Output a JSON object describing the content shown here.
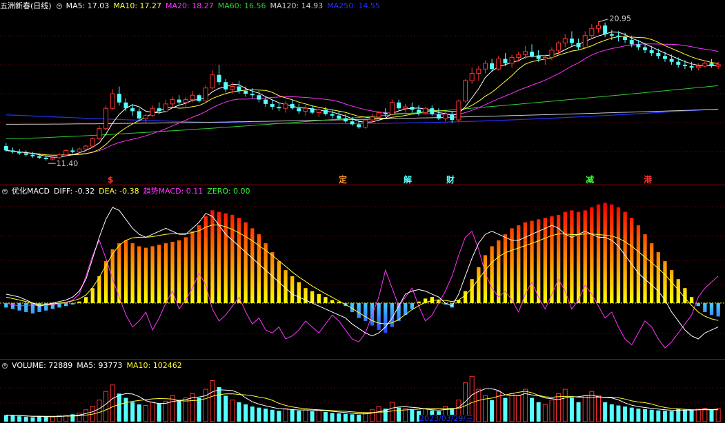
{
  "colors": {
    "bg": "#000000",
    "up": "#ff3333",
    "down": "#54ffff",
    "ma5": "#ffffff",
    "ma10": "#ffff33",
    "ma20": "#ff33ff",
    "ma60": "#33cc33",
    "ma120": "#cccccc",
    "ma250": "#2233ff",
    "grid": "#880000"
  },
  "price_panel": {
    "stock_name": "五洲新春(日线)",
    "ma5": "MA5: 17.03",
    "ma10": "MA10: 17.27",
    "ma20": "MA20: 18.27",
    "ma60": "MA60: 16.56",
    "ma120": "MA120: 14.93",
    "ma250": "MA250: 14.55",
    "high_label": "20.95",
    "low_label": "11.40",
    "events": [
      {
        "label": "$",
        "color": "#ff3333"
      },
      {
        "label": "定",
        "color": "#ff9933"
      },
      {
        "label": "解",
        "color": "#54ffff"
      },
      {
        "label": "财",
        "color": "#54ffff"
      },
      {
        "label": "减",
        "color": "#33ff33"
      },
      {
        "label": "港",
        "color": "#ff3333"
      }
    ]
  },
  "macd_panel": {
    "name": "优化MACD",
    "diff": "DIFF: -0.32",
    "dea": "DEA: -0.38",
    "trend_label": "趋势",
    "macd": "MACD: 0.11",
    "zero": "ZERO: 0.00"
  },
  "volume_panel": {
    "volume": "VOLUME: 72889",
    "ma5": "MA5: 93773",
    "ma10": "MA10: 102462",
    "date_label": "2023/03/29/三"
  },
  "chart_data": [
    {
      "type": "candlestick",
      "title": "五洲新春(日线)",
      "ylim": [
        10.6,
        21.6
      ],
      "ohlc": [
        [
          12.4,
          12.6,
          12.0,
          12.1
        ],
        [
          12.1,
          12.3,
          11.9,
          12.0
        ],
        [
          12.0,
          12.2,
          11.8,
          11.9
        ],
        [
          11.9,
          12.1,
          11.7,
          11.8
        ],
        [
          11.8,
          12.0,
          11.6,
          11.7
        ],
        [
          11.7,
          11.9,
          11.5,
          11.6
        ],
        [
          11.6,
          11.8,
          11.4,
          11.5
        ],
        [
          11.5,
          11.7,
          11.4,
          11.6
        ],
        [
          11.6,
          11.9,
          11.5,
          11.8
        ],
        [
          11.8,
          12.2,
          11.7,
          12.1
        ],
        [
          12.1,
          12.3,
          11.9,
          12.0
        ],
        [
          12.0,
          12.3,
          11.8,
          12.2
        ],
        [
          12.2,
          12.5,
          12.0,
          12.4
        ],
        [
          12.4,
          13.0,
          12.3,
          12.9
        ],
        [
          12.9,
          13.8,
          12.8,
          13.6
        ],
        [
          13.6,
          15.2,
          13.5,
          15.0
        ],
        [
          15.0,
          16.3,
          14.9,
          16.0
        ],
        [
          16.0,
          16.5,
          15.2,
          15.4
        ],
        [
          15.4,
          15.7,
          14.8,
          15.0
        ],
        [
          15.0,
          15.3,
          14.5,
          14.8
        ],
        [
          14.8,
          15.0,
          14.1,
          14.3
        ],
        [
          14.3,
          14.6,
          14.0,
          14.5
        ],
        [
          14.5,
          15.2,
          14.4,
          15.0
        ],
        [
          15.0,
          15.4,
          14.6,
          14.8
        ],
        [
          14.8,
          15.6,
          14.7,
          15.3
        ],
        [
          15.3,
          15.8,
          15.1,
          15.6
        ],
        [
          15.6,
          15.9,
          15.2,
          15.4
        ],
        [
          15.4,
          15.8,
          15.1,
          15.6
        ],
        [
          15.6,
          16.2,
          15.4,
          15.9
        ],
        [
          15.9,
          16.0,
          15.4,
          15.5
        ],
        [
          15.5,
          16.6,
          15.4,
          16.4
        ],
        [
          16.4,
          17.6,
          16.3,
          17.3
        ],
        [
          17.3,
          18.0,
          16.6,
          16.8
        ],
        [
          16.8,
          17.0,
          16.1,
          16.3
        ],
        [
          16.3,
          16.8,
          16.0,
          16.5
        ],
        [
          16.5,
          16.9,
          16.0,
          16.2
        ],
        [
          16.2,
          16.5,
          15.8,
          16.0
        ],
        [
          16.0,
          16.4,
          15.7,
          15.9
        ],
        [
          15.9,
          16.2,
          15.4,
          15.6
        ],
        [
          15.6,
          15.8,
          15.1,
          15.3
        ],
        [
          15.3,
          15.6,
          14.9,
          15.1
        ],
        [
          15.1,
          15.4,
          14.8,
          15.0
        ],
        [
          15.0,
          15.5,
          14.7,
          15.3
        ],
        [
          15.3,
          15.6,
          14.9,
          15.0
        ],
        [
          15.0,
          15.3,
          14.6,
          14.8
        ],
        [
          14.8,
          15.2,
          14.5,
          15.0
        ],
        [
          15.0,
          15.2,
          14.6,
          14.7
        ],
        [
          14.7,
          15.0,
          14.4,
          14.9
        ],
        [
          14.9,
          15.1,
          14.5,
          14.6
        ],
        [
          14.6,
          14.9,
          14.3,
          14.5
        ],
        [
          14.5,
          14.8,
          14.2,
          14.3
        ],
        [
          14.3,
          14.6,
          14.0,
          14.1
        ],
        [
          14.1,
          14.4,
          13.8,
          13.9
        ],
        [
          13.9,
          14.2,
          13.6,
          13.7
        ],
        [
          13.7,
          14.3,
          13.6,
          14.2
        ],
        [
          14.2,
          14.6,
          14.0,
          14.4
        ],
        [
          14.4,
          14.8,
          14.3,
          14.7
        ],
        [
          14.7,
          15.0,
          14.4,
          14.6
        ],
        [
          14.6,
          15.6,
          14.5,
          15.4
        ],
        [
          15.4,
          15.6,
          14.9,
          15.0
        ],
        [
          15.0,
          15.3,
          14.7,
          15.1
        ],
        [
          15.1,
          15.4,
          14.7,
          14.9
        ],
        [
          14.9,
          15.2,
          14.5,
          14.7
        ],
        [
          14.7,
          15.1,
          14.6,
          15.0
        ],
        [
          15.0,
          15.2,
          14.5,
          14.6
        ],
        [
          14.6,
          15.0,
          14.2,
          14.3
        ],
        [
          14.3,
          14.8,
          14.1,
          14.6
        ],
        [
          14.6,
          14.8,
          14.0,
          14.2
        ],
        [
          14.2,
          15.6,
          14.1,
          15.5
        ],
        [
          15.5,
          17.0,
          15.4,
          16.9
        ],
        [
          16.9,
          17.8,
          16.7,
          17.4
        ],
        [
          17.4,
          17.9,
          16.9,
          17.7
        ],
        [
          17.7,
          18.3,
          17.4,
          18.1
        ],
        [
          18.1,
          18.4,
          17.5,
          17.7
        ],
        [
          17.7,
          18.6,
          17.6,
          18.4
        ],
        [
          18.4,
          18.8,
          17.9,
          18.1
        ],
        [
          18.1,
          18.7,
          17.8,
          18.5
        ],
        [
          18.5,
          18.9,
          18.2,
          18.7
        ],
        [
          18.7,
          19.3,
          18.4,
          18.9
        ],
        [
          18.9,
          19.4,
          18.5,
          18.6
        ],
        [
          18.6,
          19.0,
          18.2,
          18.4
        ],
        [
          18.4,
          18.7,
          18.0,
          18.5
        ],
        [
          18.5,
          19.2,
          18.3,
          19.0
        ],
        [
          19.0,
          19.6,
          18.8,
          19.5
        ],
        [
          19.5,
          20.1,
          19.2,
          19.8
        ],
        [
          19.8,
          20.3,
          19.3,
          19.5
        ],
        [
          19.5,
          19.8,
          19.0,
          19.2
        ],
        [
          19.2,
          20.3,
          19.1,
          20.0
        ],
        [
          20.0,
          20.8,
          19.8,
          20.5
        ],
        [
          20.5,
          20.95,
          20.2,
          20.7
        ],
        [
          20.7,
          20.9,
          19.9,
          20.1
        ],
        [
          20.1,
          20.4,
          19.7,
          20.0
        ],
        [
          20.0,
          20.3,
          19.6,
          19.9
        ],
        [
          19.9,
          20.2,
          19.5,
          19.7
        ],
        [
          19.7,
          20.0,
          19.2,
          19.4
        ],
        [
          19.4,
          19.7,
          19.0,
          19.2
        ],
        [
          19.2,
          19.5,
          18.8,
          19.0
        ],
        [
          19.0,
          19.3,
          18.6,
          18.8
        ],
        [
          18.8,
          19.1,
          18.4,
          18.6
        ],
        [
          18.6,
          18.9,
          18.2,
          18.4
        ],
        [
          18.4,
          18.7,
          18.0,
          18.2
        ],
        [
          18.2,
          18.5,
          17.8,
          18.0
        ],
        [
          18.0,
          18.3,
          17.7,
          17.9
        ],
        [
          17.9,
          18.2,
          17.6,
          17.8
        ],
        [
          17.8,
          18.1,
          17.6,
          17.9
        ],
        [
          17.9,
          18.3,
          17.8,
          18.1
        ],
        [
          18.1,
          18.4,
          17.8,
          17.9
        ],
        [
          17.9,
          18.2,
          17.7,
          18.0
        ]
      ]
    },
    {
      "type": "bar",
      "title": "优化MACD",
      "ylim": [
        -1.8,
        3.5
      ],
      "macd": [
        -0.15,
        -0.2,
        -0.25,
        -0.3,
        -0.35,
        -0.3,
        -0.25,
        -0.2,
        -0.15,
        -0.1,
        -0.05,
        0.05,
        0.2,
        0.5,
        0.9,
        1.4,
        1.8,
        2.0,
        2.1,
        2.0,
        1.9,
        1.85,
        1.9,
        1.95,
        2.0,
        2.05,
        2.1,
        2.2,
        2.4,
        2.6,
        2.9,
        3.1,
        3.05,
        3.0,
        2.95,
        2.85,
        2.7,
        2.5,
        2.3,
        2.0,
        1.7,
        1.4,
        1.1,
        0.9,
        0.7,
        0.5,
        0.4,
        0.3,
        0.2,
        0.1,
        0.05,
        -0.1,
        -0.3,
        -0.5,
        -0.6,
        -0.75,
        -0.9,
        -1.0,
        -0.8,
        -0.6,
        -0.4,
        -0.2,
        0.05,
        0.15,
        0.2,
        0.1,
        -0.05,
        -0.15,
        0.1,
        0.4,
        0.8,
        1.2,
        1.6,
        1.9,
        2.1,
        2.3,
        2.5,
        2.6,
        2.7,
        2.75,
        2.8,
        2.85,
        2.9,
        2.95,
        3.05,
        3.1,
        3.05,
        3.1,
        3.2,
        3.3,
        3.35,
        3.3,
        3.2,
        3.05,
        2.85,
        2.6,
        2.3,
        2.0,
        1.7,
        1.4,
        1.1,
        0.8,
        0.5,
        0.2,
        -0.1,
        -0.3,
        -0.4,
        -0.45
      ],
      "diff": [
        0.3,
        0.25,
        0.2,
        0.1,
        0.0,
        -0.1,
        -0.05,
        0.0,
        0.05,
        0.1,
        0.2,
        0.4,
        0.8,
        1.5,
        2.2,
        2.8,
        3.2,
        3.1,
        2.8,
        2.5,
        2.3,
        2.2,
        2.3,
        2.4,
        2.5,
        2.4,
        2.3,
        2.3,
        2.5,
        2.7,
        3.0,
        2.9,
        2.6,
        2.3,
        2.1,
        1.9,
        1.7,
        1.5,
        1.3,
        1.1,
        0.9,
        0.7,
        0.5,
        0.3,
        0.2,
        0.1,
        0.0,
        -0.1,
        -0.2,
        -0.3,
        -0.4,
        -0.5,
        -0.7,
        -0.85,
        -1.0,
        -1.1,
        -1.0,
        -0.8,
        -0.5,
        -0.1,
        0.3,
        0.4,
        0.45,
        0.4,
        0.3,
        0.2,
        0.0,
        -0.1,
        0.3,
        0.9,
        1.5,
        2.0,
        2.3,
        2.4,
        2.3,
        2.2,
        2.1,
        2.1,
        2.2,
        2.3,
        2.4,
        2.5,
        2.6,
        2.5,
        2.3,
        2.2,
        2.3,
        2.4,
        2.3,
        2.2,
        2.2,
        2.1,
        1.9,
        1.6,
        1.3,
        1.0,
        0.8,
        0.6,
        0.4,
        0.1,
        -0.3,
        -0.6,
        -0.9,
        -1.1,
        -1.2,
        -1.0,
        -0.9,
        -0.8
      ],
      "dea": [
        0.2,
        0.15,
        0.1,
        0.05,
        0.0,
        -0.05,
        -0.05,
        -0.03,
        0.0,
        0.03,
        0.07,
        0.14,
        0.27,
        0.52,
        0.86,
        1.25,
        1.64,
        1.93,
        2.1,
        2.18,
        2.2,
        2.2,
        2.22,
        2.26,
        2.3,
        2.32,
        2.32,
        2.32,
        2.36,
        2.42,
        2.54,
        2.61,
        2.61,
        2.55,
        2.46,
        2.35,
        2.22,
        2.08,
        1.92,
        1.76,
        1.59,
        1.41,
        1.23,
        1.04,
        0.87,
        0.72,
        0.57,
        0.44,
        0.31,
        0.19,
        0.07,
        -0.05,
        -0.18,
        -0.32,
        -0.46,
        -0.59,
        -0.67,
        -0.7,
        -0.66,
        -0.55,
        -0.38,
        -0.22,
        -0.09,
        0.02,
        0.08,
        0.11,
        0.09,
        0.05,
        0.1,
        0.26,
        0.5,
        0.8,
        1.1,
        1.36,
        1.55,
        1.68,
        1.77,
        1.84,
        1.92,
        2.0,
        2.08,
        2.17,
        2.26,
        2.31,
        2.31,
        2.29,
        2.29,
        2.31,
        2.31,
        2.29,
        2.27,
        2.24,
        2.17,
        2.05,
        1.9,
        1.72,
        1.54,
        1.35,
        1.16,
        0.95,
        0.7,
        0.44,
        0.17,
        -0.08,
        -0.3,
        -0.44,
        -0.53,
        -0.58
      ],
      "trend": [
        0.0,
        -0.05,
        -0.1,
        -0.08,
        -0.06,
        -0.1,
        -0.08,
        -0.05,
        -0.02,
        0.0,
        0.1,
        0.3,
        0.9,
        1.6,
        2.1,
        1.5,
        0.8,
        0.2,
        -0.4,
        -0.8,
        -0.6,
        -0.3,
        -0.9,
        -0.5,
        0.0,
        0.4,
        -0.2,
        0.1,
        0.5,
        1.0,
        0.6,
        -0.2,
        -0.6,
        -0.4,
        -0.1,
        0.2,
        -0.3,
        -0.7,
        -0.5,
        -0.9,
        -1.0,
        -0.8,
        -1.2,
        -1.1,
        -0.9,
        -0.6,
        -0.8,
        -1.0,
        -0.7,
        -0.4,
        -0.6,
        -0.9,
        -1.2,
        -1.3,
        -1.0,
        -0.4,
        0.2,
        1.1,
        0.5,
        -0.1,
        0.2,
        0.5,
        -0.1,
        -0.6,
        -0.4,
        0.0,
        0.4,
        0.9,
        1.6,
        2.2,
        2.4,
        1.8,
        1.0,
        0.5,
        0.2,
        0.4,
        0.1,
        -0.3,
        0.3,
        0.7,
        0.2,
        -0.2,
        0.3,
        0.8,
        0.4,
        -0.2,
        0.1,
        0.6,
        0.3,
        -0.1,
        -0.5,
        -0.3,
        -0.8,
        -1.2,
        -1.4,
        -1.0,
        -0.6,
        -0.8,
        -1.2,
        -1.5,
        -1.3,
        -1.0,
        -0.7,
        -0.4,
        0.2,
        0.5,
        0.7,
        0.9
      ]
    },
    {
      "type": "bar",
      "title": "VOLUME",
      "ylim": [
        0,
        230000
      ],
      "volume": [
        30000,
        28000,
        25000,
        22000,
        20000,
        26000,
        24000,
        22000,
        28000,
        30000,
        34000,
        40000,
        55000,
        70000,
        100000,
        140000,
        170000,
        130000,
        110000,
        90000,
        80000,
        75000,
        90000,
        85000,
        95000,
        120000,
        100000,
        110000,
        130000,
        110000,
        150000,
        190000,
        160000,
        120000,
        100000,
        90000,
        80000,
        70000,
        65000,
        60000,
        55000,
        50000,
        60000,
        55000,
        50000,
        55000,
        48000,
        52000,
        45000,
        40000,
        38000,
        36000,
        34000,
        32000,
        40000,
        55000,
        70000,
        60000,
        90000,
        65000,
        60000,
        55000,
        50000,
        60000,
        52000,
        48000,
        70000,
        60000,
        100000,
        180000,
        210000,
        150000,
        120000,
        100000,
        140000,
        110000,
        130000,
        120000,
        150000,
        110000,
        90000,
        80000,
        100000,
        130000,
        150000,
        110000,
        90000,
        120000,
        140000,
        120000,
        90000,
        80000,
        75000,
        70000,
        65000,
        60000,
        58000,
        55000,
        52000,
        50000,
        48000,
        60000,
        55000,
        52000,
        58000,
        62000,
        54000,
        60000
      ],
      "ma5_value": 93773,
      "ma10_value": 102462
    }
  ]
}
